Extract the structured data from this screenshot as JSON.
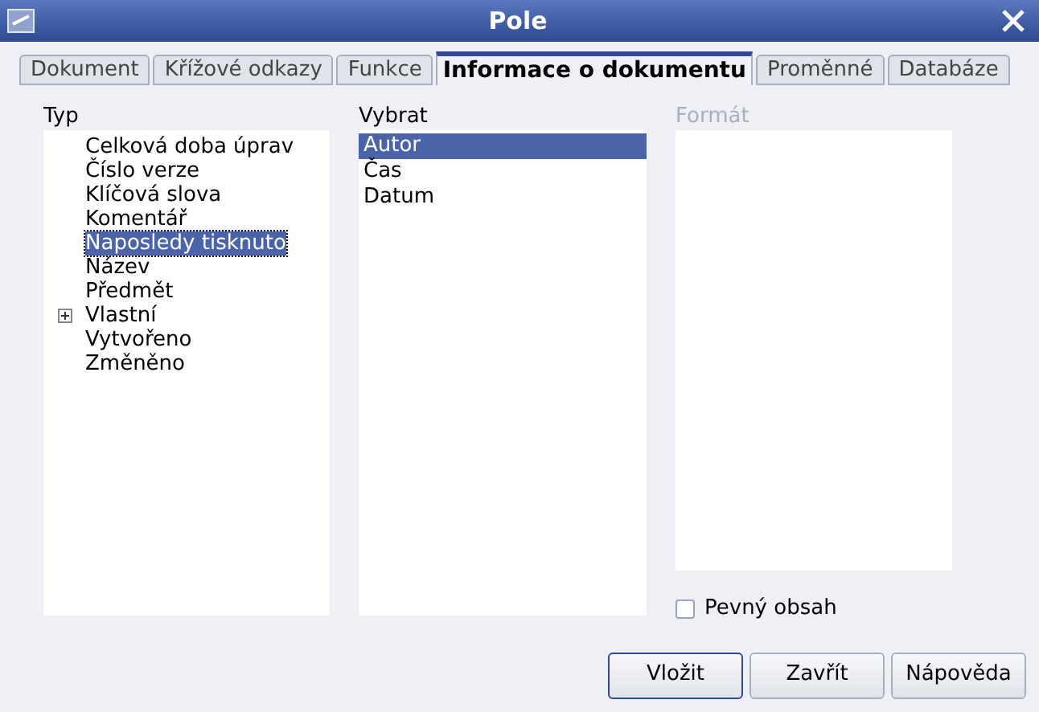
{
  "window": {
    "title": "Pole"
  },
  "tabs": [
    {
      "label": "Dokument",
      "selected": false
    },
    {
      "label": "Křížové odkazy",
      "selected": false
    },
    {
      "label": "Funkce",
      "selected": false
    },
    {
      "label": "Informace o dokumentu",
      "selected": true
    },
    {
      "label": "Proměnné",
      "selected": false
    },
    {
      "label": "Databáze",
      "selected": false
    }
  ],
  "type_list": {
    "label": "Typ",
    "items": [
      {
        "label": "Celková doba úprav",
        "kind": "leaf",
        "selected": false
      },
      {
        "label": "Číslo verze",
        "kind": "leaf",
        "selected": false
      },
      {
        "label": "Klíčová slova",
        "kind": "leaf",
        "selected": false
      },
      {
        "label": "Komentář",
        "kind": "leaf",
        "selected": false
      },
      {
        "label": "Naposledy tisknuto",
        "kind": "leaf",
        "selected": true
      },
      {
        "label": "Název",
        "kind": "leaf",
        "selected": false
      },
      {
        "label": "Předmět",
        "kind": "leaf",
        "selected": false
      },
      {
        "label": "Vlastní",
        "kind": "group",
        "selected": false
      },
      {
        "label": "Vytvořeno",
        "kind": "leaf",
        "selected": false
      },
      {
        "label": "Změněno",
        "kind": "leaf",
        "selected": false
      }
    ]
  },
  "select_list": {
    "label": "Vybrat",
    "items": [
      {
        "label": "Autor",
        "selected": true
      },
      {
        "label": "Čas",
        "selected": false
      },
      {
        "label": "Datum",
        "selected": false
      }
    ]
  },
  "format_list": {
    "label": "Formát",
    "disabled": true
  },
  "fixed_content": {
    "label": "Pevný obsah",
    "checked": false
  },
  "buttons": [
    {
      "label": "Vložit",
      "default": true
    },
    {
      "label": "Zavřít",
      "default": false
    },
    {
      "label": "Nápověda",
      "default": false
    }
  ]
}
